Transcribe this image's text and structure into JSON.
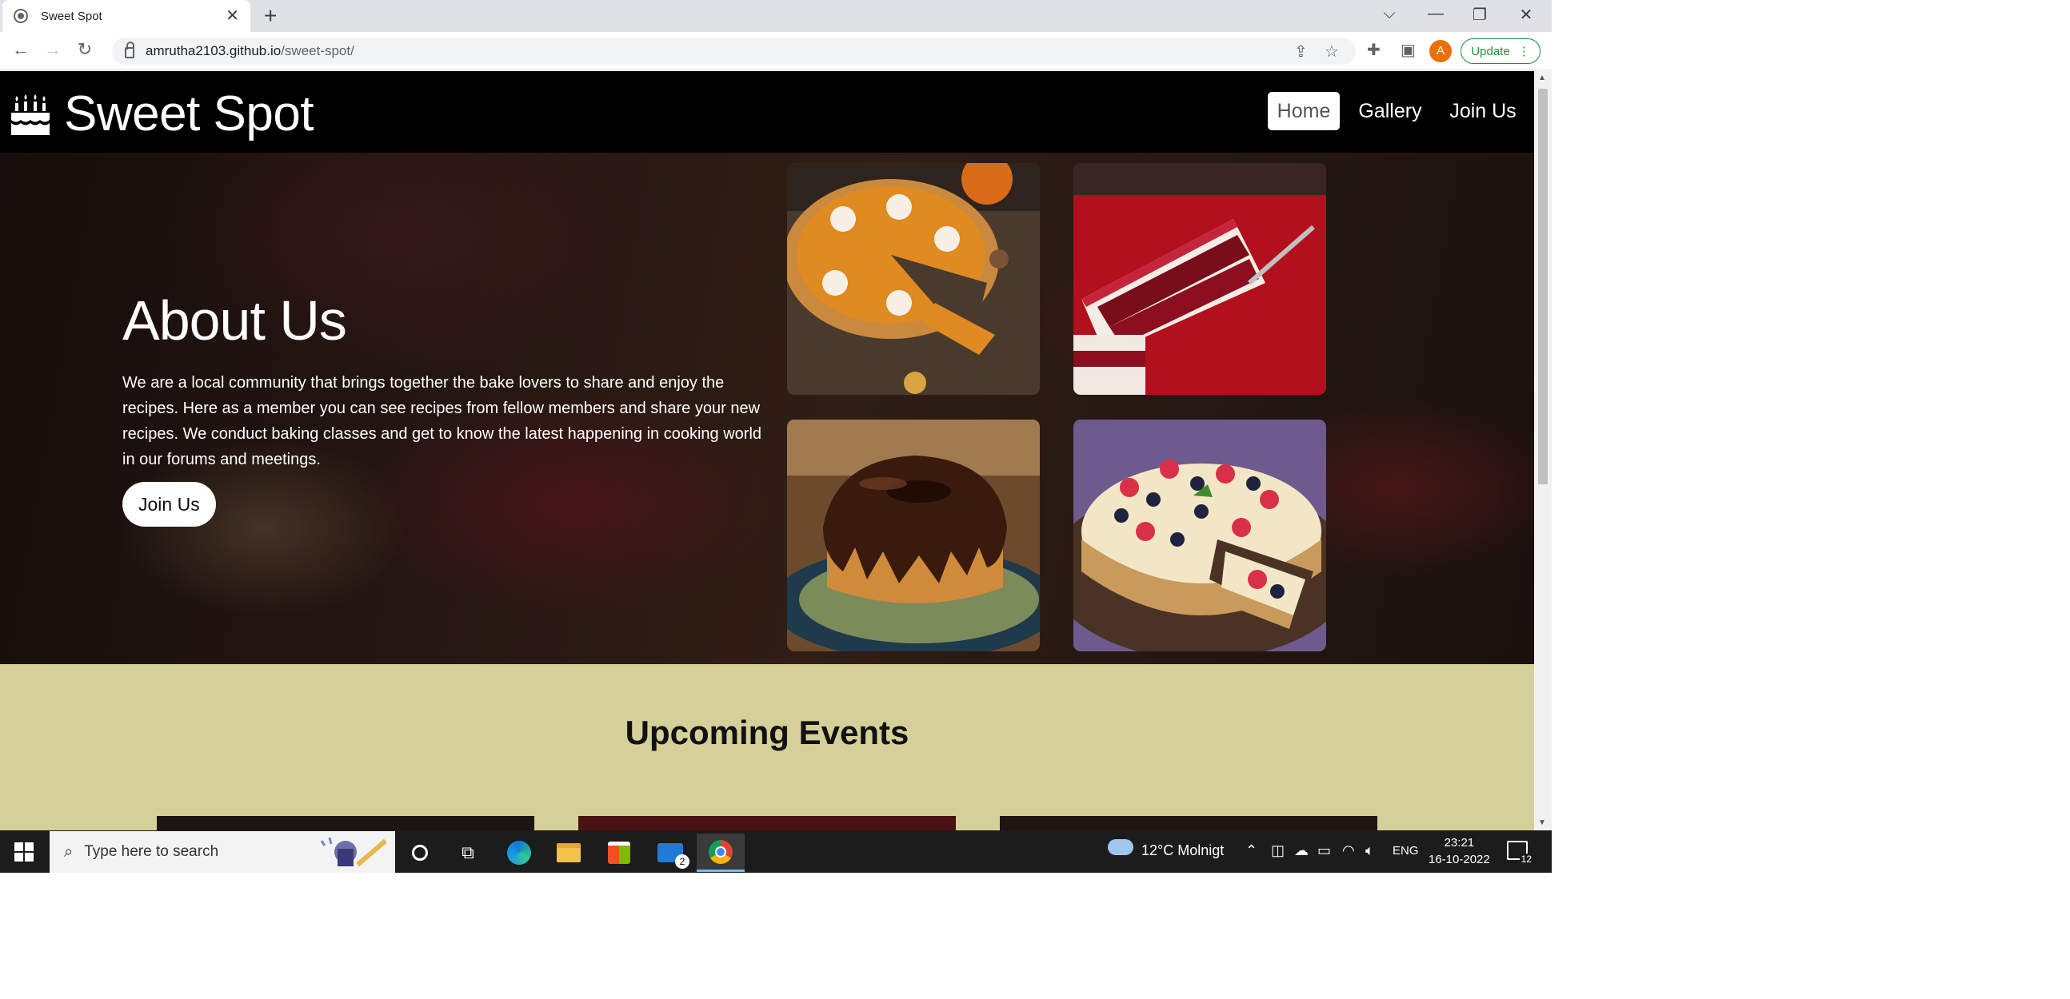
{
  "browser": {
    "tab_title": "Sweet Spot",
    "tab_close": "✕",
    "new_tab": "+",
    "url_host": "amrutha2103.github.io",
    "url_path": "/sweet-spot/",
    "avatar_letter": "A",
    "update_label": "Update"
  },
  "site": {
    "logo_text": "Sweet Spot",
    "nav": [
      "Home",
      "Gallery",
      "Join Us"
    ],
    "about_title": "About Us",
    "about_lines": [
      "We are a local community that brings together the bake lovers to share and enjoy the",
      "recipes. Here as a member you can see recipes from fellow members and share your new",
      "recipes. We conduct baking classes and get to know the latest happening in cooking world",
      "in our forums and meetings."
    ],
    "join_button": "Join Us",
    "events_title": "Upcoming Events",
    "photos": [
      "pumpkin-pie-photo",
      "red-velvet-cake-photo",
      "chocolate-bundt-cake-photo",
      "berry-cheesecake-photo"
    ]
  },
  "taskbar": {
    "search_placeholder": "Type here to search",
    "weather": "12°C  Molnigt",
    "language": "ENG",
    "time": "23:21",
    "date": "16-10-2022",
    "notification_count": "12",
    "mail_badge": "2"
  },
  "colors": {
    "events_bg": "#d5cf99",
    "nav_bg": "#000000",
    "update_green": "#1e8e3e"
  }
}
